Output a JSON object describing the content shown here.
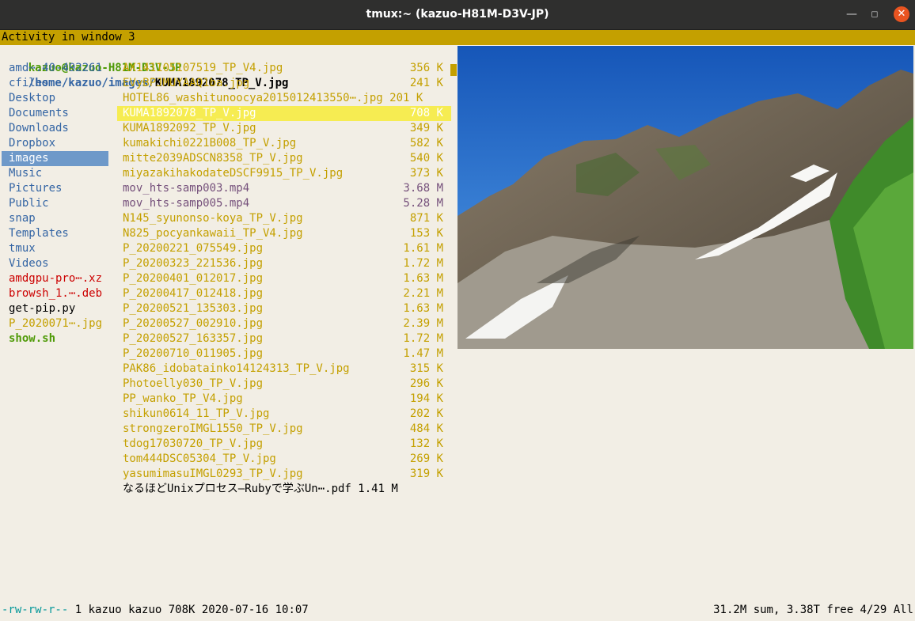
{
  "window": {
    "title": "tmux:~ (kazuo-H81M-D3V-JP)"
  },
  "activity_bar": "Activity in window 3",
  "path": {
    "userhost": "kazuo@kazuo-H81M-D3V-JP",
    "dir": "/home/kazuo/images/",
    "file": "KUMA1892078_TP_V.jpg"
  },
  "parent_dir_items": [
    {
      "label": "amd⋯.40-492261",
      "kind": "dir"
    },
    {
      "label": "cfiles",
      "kind": "dir"
    },
    {
      "label": "Desktop",
      "kind": "dir"
    },
    {
      "label": "Documents",
      "kind": "dir"
    },
    {
      "label": "Downloads",
      "kind": "dir"
    },
    {
      "label": "Dropbox",
      "kind": "dir"
    },
    {
      "label": "images",
      "kind": "dir-selected"
    },
    {
      "label": "Music",
      "kind": "dir"
    },
    {
      "label": "Pictures",
      "kind": "dir"
    },
    {
      "label": "Public",
      "kind": "dir"
    },
    {
      "label": "snap",
      "kind": "dir"
    },
    {
      "label": "Templates",
      "kind": "dir"
    },
    {
      "label": "tmux",
      "kind": "dir"
    },
    {
      "label": "Videos",
      "kind": "dir"
    },
    {
      "label": "amdgpu-pro⋯.xz",
      "kind": "archive"
    },
    {
      "label": "browsh_1.⋯.deb",
      "kind": "archive"
    },
    {
      "label": "get-pip.py",
      "kind": "file"
    },
    {
      "label": "P_2020071⋯.jpg",
      "kind": "image"
    },
    {
      "label": "show.sh",
      "kind": "exec"
    }
  ],
  "files": [
    {
      "name": "AX141105107519_TP_V4.jpg",
      "size": "356 K",
      "kind": "image"
    },
    {
      "name": "EVyBPJMUYAAQ1ba.jpg",
      "size": "241 K",
      "kind": "image"
    },
    {
      "name": "HOTEL86_washitunoocya2015012413550⋯.jpg 201 K",
      "size": "",
      "kind": "image"
    },
    {
      "name": "KUMA1892078_TP_V.jpg",
      "size": "708 K",
      "kind": "selected"
    },
    {
      "name": "KUMA1892092_TP_V.jpg",
      "size": "349 K",
      "kind": "image"
    },
    {
      "name": "kumakichi0221B008_TP_V.jpg",
      "size": "582 K",
      "kind": "image"
    },
    {
      "name": "mitte2039ADSCN8358_TP_V.jpg",
      "size": "540 K",
      "kind": "image"
    },
    {
      "name": "miyazakihakodateDSCF9915_TP_V.jpg",
      "size": "373 K",
      "kind": "image"
    },
    {
      "name": "mov_hts-samp003.mp4",
      "size": "3.68 M",
      "kind": "video"
    },
    {
      "name": "mov_hts-samp005.mp4",
      "size": "5.28 M",
      "kind": "video"
    },
    {
      "name": "N145_syunonso-koya_TP_V.jpg",
      "size": "871 K",
      "kind": "image"
    },
    {
      "name": "N825_pocyankawaii_TP_V4.jpg",
      "size": "153 K",
      "kind": "image"
    },
    {
      "name": "P_20200221_075549.jpg",
      "size": "1.61 M",
      "kind": "image"
    },
    {
      "name": "P_20200323_221536.jpg",
      "size": "1.72 M",
      "kind": "image"
    },
    {
      "name": "P_20200401_012017.jpg",
      "size": "1.63 M",
      "kind": "image"
    },
    {
      "name": "P_20200417_012418.jpg",
      "size": "2.21 M",
      "kind": "image"
    },
    {
      "name": "P_20200521_135303.jpg",
      "size": "1.63 M",
      "kind": "image"
    },
    {
      "name": "P_20200527_002910.jpg",
      "size": "2.39 M",
      "kind": "image"
    },
    {
      "name": "P_20200527_163357.jpg",
      "size": "1.72 M",
      "kind": "image"
    },
    {
      "name": "P_20200710_011905.jpg",
      "size": "1.47 M",
      "kind": "image"
    },
    {
      "name": "PAK86_idobatainko14124313_TP_V.jpg",
      "size": "315 K",
      "kind": "image"
    },
    {
      "name": "Photoelly030_TP_V.jpg",
      "size": "296 K",
      "kind": "image"
    },
    {
      "name": "PP_wanko_TP_V4.jpg",
      "size": "194 K",
      "kind": "image"
    },
    {
      "name": "shikun0614_11_TP_V.jpg",
      "size": "202 K",
      "kind": "image"
    },
    {
      "name": "strongzeroIMGL1550_TP_V.jpg",
      "size": "484 K",
      "kind": "image"
    },
    {
      "name": "tdog17030720_TP_V.jpg",
      "size": "132 K",
      "kind": "image"
    },
    {
      "name": "tom444DSC05304_TP_V.jpg",
      "size": "269 K",
      "kind": "image"
    },
    {
      "name": "yasumimasuIMGL0293_TP_V.jpg",
      "size": "319 K",
      "kind": "image"
    },
    {
      "name": "なるほどUnixプロセス—Rubyで学ぶUn⋯.pdf 1.41 M",
      "size": "",
      "kind": "doc"
    }
  ],
  "status": {
    "perms": "-rw-rw-r--",
    "info": " 1 kazuo kazuo 708K 2020-07-16 10:07",
    "right": "31.2M sum, 3.38T free  4/29  All"
  },
  "colors": {
    "dir": "#3465a4",
    "image": "#c4a000",
    "video": "#75507b",
    "archive": "#cc0000",
    "exec": "#4e9a06",
    "selected_bg": "#f6ec52",
    "dir_selected_bg": "#6e99c9"
  },
  "icons": {
    "minimize": "minimize-icon",
    "maximize": "maximize-icon",
    "close": "close-icon"
  }
}
